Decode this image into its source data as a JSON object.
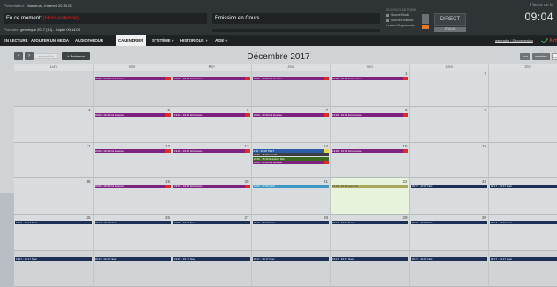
{
  "topbar": {
    "producer_label": "Présentateur",
    "producer_value": "Masterus - Internet, 20.50.00",
    "now_label": "En ce moment",
    "now_value": "(Hors antenne)",
    "emission_label": "Emission en Cours",
    "previous_label": "Prochain",
    "previous_value": "generique 2017 (13) - Copie, 00:14:00",
    "sources_title": "SOURCES ANTENNE",
    "source_studio": "Source Studio",
    "source_emission": "Source Emission",
    "source_programmed": "Lecture Programmée",
    "direct_label": "DIRECT",
    "lang_label": "STUDIO",
    "time_label": "Heure de la",
    "time_value": "09:04"
  },
  "menu": {
    "items": [
      {
        "label": "EN LECTURE"
      },
      {
        "label": "AJOUTER UN MEDIA"
      },
      {
        "label": "AUDIOTHEQUE"
      },
      {
        "label": "CALENDRIER",
        "active": true
      },
      {
        "label": "SYSTÈME",
        "caret": true
      },
      {
        "label": "HISTORIQUE",
        "caret": true
      },
      {
        "label": "AIDE",
        "caret": true
      }
    ],
    "user": "webradio",
    "logout": "Déconnexion",
    "extra": "Airti"
  },
  "toolbar": {
    "prev_icon": "chevron-left",
    "next_icon": "chevron-right",
    "today_label": "aujourd'hui",
    "emit_label": "+ Emission",
    "title": "Décembre 2017",
    "views": [
      "jour",
      "semaine",
      "mois"
    ]
  },
  "calendar": {
    "days": [
      "Lun",
      "Mar",
      "Mer",
      "Jeu",
      "Ven",
      "Sam",
      "Dim"
    ],
    "weeks": [
      [
        "",
        "",
        "",
        "",
        "1",
        "2",
        "3"
      ],
      [
        "4",
        "5",
        "6",
        "7",
        "8",
        "9",
        "10"
      ],
      [
        "11",
        "12",
        "13",
        "14",
        "15",
        "16",
        "17"
      ],
      [
        "18",
        "19",
        "20",
        "21",
        "22",
        "23",
        "24"
      ],
      [
        "25",
        "26",
        "27",
        "28",
        "29",
        "30",
        "31"
      ],
      [
        "",
        "",
        "",
        "",
        "",
        "",
        ""
      ]
    ],
    "today": [
      3,
      4
    ],
    "events": [
      {
        "w": 0,
        "d": 1,
        "row": 0,
        "text": "19:00 - 19:30 bol lucense",
        "color": "purple",
        "tag": true
      },
      {
        "w": 0,
        "d": 2,
        "row": 0,
        "text": "19:00 - 19:30 bol lucense",
        "color": "purple",
        "tag": true
      },
      {
        "w": 0,
        "d": 3,
        "row": 0,
        "text": "19:00 - 19:30 bol lucense",
        "color": "purple",
        "tag": true
      },
      {
        "w": 0,
        "d": 4,
        "row": 0,
        "text": "19:00 - 19:30 bol lucense",
        "color": "purple",
        "tag": true
      },
      {
        "w": 1,
        "d": 1,
        "row": 0,
        "text": "19:00 - 19:30 bol lucense",
        "color": "purple",
        "tag": true
      },
      {
        "w": 1,
        "d": 2,
        "row": 0,
        "text": "19:00 - 19:30 bol lucense",
        "color": "purple",
        "tag": true
      },
      {
        "w": 1,
        "d": 3,
        "row": 0,
        "text": "19:00 - 19:30 bol lucense",
        "color": "purple",
        "tag": true
      },
      {
        "w": 1,
        "d": 4,
        "row": 0,
        "text": "19:00 - 19:30 bol lucense",
        "color": "purple",
        "tag": true
      },
      {
        "w": 2,
        "d": 1,
        "row": 0,
        "text": "19:00 - 19:30 bol lucense",
        "color": "purple",
        "tag": true
      },
      {
        "w": 2,
        "d": 2,
        "row": 0,
        "text": "19:00 - 19:30 bol lucense",
        "color": "purple",
        "tag": true
      },
      {
        "w": 2,
        "d": 3,
        "row": 0,
        "text": "9:00 - 09:00 TEST",
        "color": "blue",
        "tag": true,
        "tagyel": true
      },
      {
        "w": 2,
        "d": 3,
        "row": 1,
        "text": "16:00 - 16:00 test TS",
        "color": "gray"
      },
      {
        "w": 2,
        "d": 3,
        "row": 2,
        "text": "16:30 - 16:30 Emission Dim",
        "color": "green"
      },
      {
        "w": 2,
        "d": 3,
        "row": 3,
        "text": "19:00 - 19:30 bol lucense",
        "color": "purple",
        "tag": true
      },
      {
        "w": 2,
        "d": 4,
        "row": 0,
        "text": "19:00 - 19:30 bol lucense",
        "color": "purple",
        "tag": true
      },
      {
        "w": 3,
        "d": 1,
        "row": 0,
        "text": "19:00 - 19:30 bol lucense",
        "color": "purple",
        "tag": true
      },
      {
        "w": 3,
        "d": 2,
        "row": 0,
        "text": "19:00 - 19:30 bol lucense",
        "color": "purple",
        "tag": true
      },
      {
        "w": 3,
        "d": 3,
        "row": 0,
        "text": "14:00 - 17:00 puub",
        "color": "teal"
      },
      {
        "w": 3,
        "d": 4,
        "row": 0,
        "text": "12:20 - 13:00 sam test",
        "color": "olive"
      },
      {
        "w": 3,
        "d": 5,
        "row": 0,
        "text": "19:17 - 19:17 Noel",
        "color": "navy"
      },
      {
        "w": 3,
        "d": 6,
        "row": 0,
        "text": "19:17 - 19:17 Noel",
        "color": "navy"
      },
      {
        "w": 4,
        "d": 0,
        "row": 0,
        "text": "19:17 - 19:17 Noel",
        "color": "navy"
      },
      {
        "w": 4,
        "d": 1,
        "row": 0,
        "text": "19:17 - 19:17 Noel",
        "color": "navy"
      },
      {
        "w": 4,
        "d": 2,
        "row": 0,
        "text": "19:17 - 19:17 Noel",
        "color": "navy"
      },
      {
        "w": 4,
        "d": 3,
        "row": 0,
        "text": "19:17 - 19:17 Noel",
        "color": "navy"
      },
      {
        "w": 4,
        "d": 4,
        "row": 0,
        "text": "19:17 - 19:17 Noel",
        "color": "navy"
      },
      {
        "w": 4,
        "d": 5,
        "row": 0,
        "text": "19:17 - 19:17 Noel",
        "color": "navy"
      },
      {
        "w": 4,
        "d": 6,
        "row": 0,
        "text": "19:17 - 19:17 Noel",
        "color": "navy"
      },
      {
        "w": 5,
        "d": 0,
        "row": 0,
        "text": "19:17 - 19:17 Noel",
        "color": "navy"
      },
      {
        "w": 5,
        "d": 1,
        "row": 0,
        "text": "19:17 - 19:17 Noel",
        "color": "navy"
      },
      {
        "w": 5,
        "d": 2,
        "row": 0,
        "text": "19:17 - 19:17 Noel",
        "color": "navy"
      },
      {
        "w": 5,
        "d": 3,
        "row": 0,
        "text": "19:17 - 19:17 Noel",
        "color": "navy"
      },
      {
        "w": 5,
        "d": 4,
        "row": 0,
        "text": "19:17 - 19:17 Noel",
        "color": "navy"
      },
      {
        "w": 5,
        "d": 5,
        "row": 0,
        "text": "19:17 - 19:17 Noel",
        "color": "navy"
      },
      {
        "w": 5,
        "d": 6,
        "row": 0,
        "text": "19:17 - 19:17 Noel",
        "color": "navy"
      }
    ]
  }
}
